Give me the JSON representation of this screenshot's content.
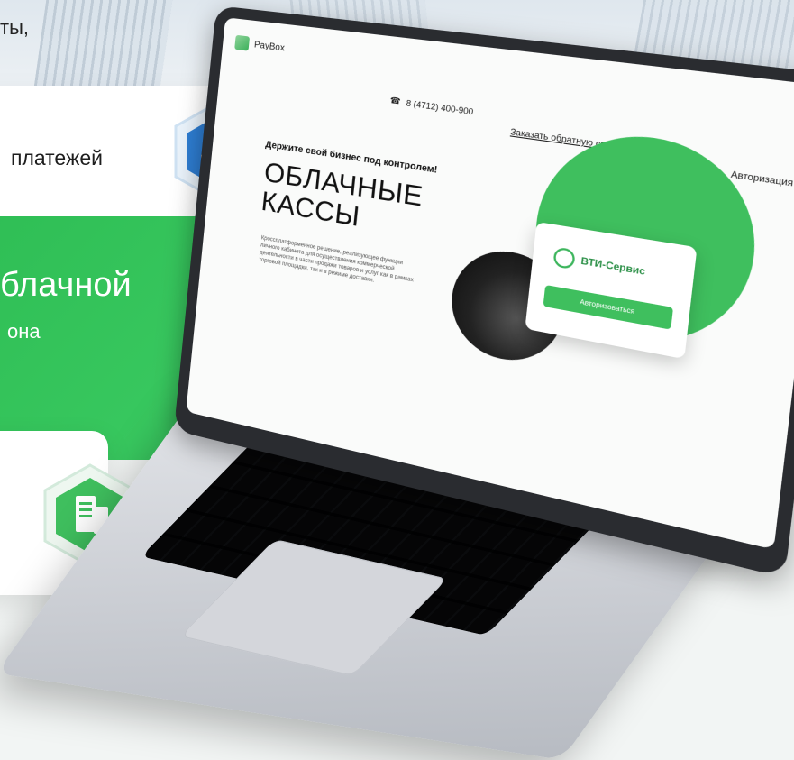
{
  "left": {
    "text_top": "ты,",
    "payments": "платежей",
    "cloud": "блачной",
    "zone": "она"
  },
  "icons": {
    "payment_badge": "hand-cash-icon",
    "receipt_badge": "receipt-icon"
  },
  "colors": {
    "brand_green": "#3fbf5e",
    "badge_blue": "#2d7dd2"
  },
  "screen": {
    "logo": "PayBox",
    "phone": "8 (4712) 400-900",
    "callback": "Заказать обратную связь",
    "auth": "Авторизация",
    "subtitle": "Держите свой бизнес под контролем!",
    "title_line1": "ОБЛАЧНЫЕ",
    "title_line2": "КАССЫ",
    "description": "Кроссплатформенное решение, реализующее функции личного кабинета для осуществления коммерческой деятельности в части продажи товаров и услуг как в рамках торговой площадки, так и в режиме доставки.",
    "card_brand": "ВТИ-Сервис",
    "card_button": "Авторизоваться"
  }
}
